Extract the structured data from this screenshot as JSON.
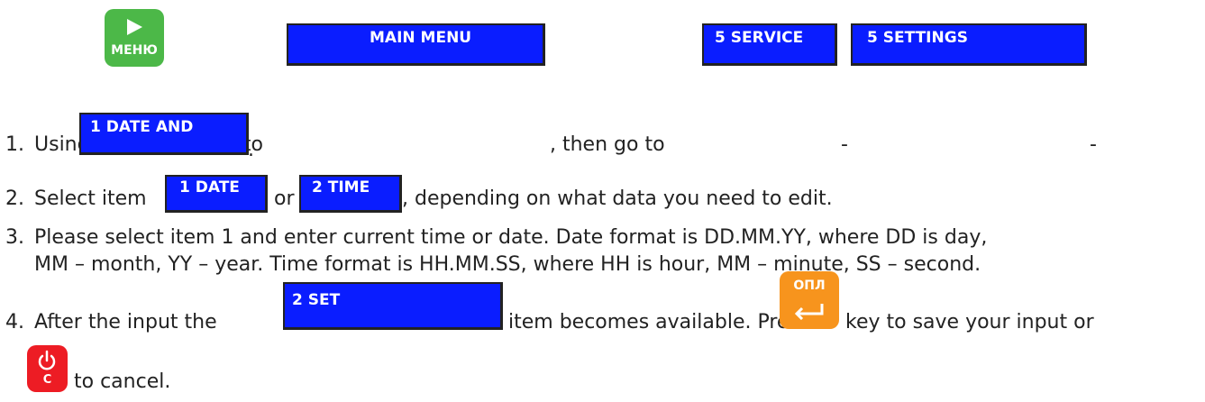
{
  "steps": [
    {
      "number": "1.",
      "using": "Using",
      "key_go_to": "key go to",
      "then_go_to": ", then go to",
      "dash1": "-",
      "dash2": "-",
      "period": "."
    },
    {
      "number": "2.",
      "select_item": "Select item",
      "or": "or",
      "rest": ", depending on what data you need to edit."
    },
    {
      "number": "3.",
      "line1": "Please select item 1 and enter current time or date. Date format is DD.MM.YY, where DD is day,",
      "line2": "MM – month, YY – year. Time format is HH.MM.SS, where HH is hour, MM – minute, SS – second."
    },
    {
      "number": "4.",
      "after_input": "After the input the",
      "becomes_available": "item becomes available. Press",
      "key_save": "key to save your input or",
      "to_cancel": "to cancel."
    }
  ],
  "screens": {
    "main_menu": "MAIN MENU",
    "service": "5 SERVICE",
    "settings": "5 SETTINGS",
    "date_and": "1 DATE AND",
    "date": "1 DATE",
    "time": "2 TIME",
    "set": "2 SET"
  },
  "keys": {
    "menu": {
      "label": "МЕНЮ",
      "icon": "play-icon",
      "color": "#4cb848"
    },
    "pay": {
      "label": "ОПЛ",
      "icon": "enter-arrow-icon",
      "color": "#f7941d"
    },
    "cancel": {
      "label": "C",
      "icon": "power-icon",
      "color": "#ed1c24"
    }
  },
  "colors": {
    "screen_blue": "#0a1dff",
    "text": "#222222"
  }
}
